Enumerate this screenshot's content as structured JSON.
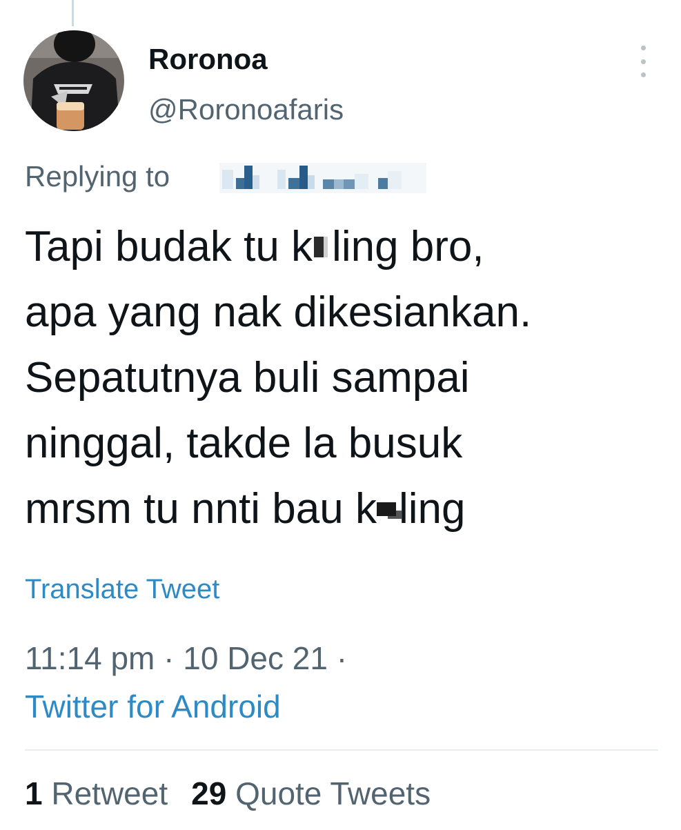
{
  "user": {
    "display_name": "Roronoa",
    "handle": "@Roronoafaris",
    "avatar_icon": "user-avatar"
  },
  "reply": {
    "label": "Replying to",
    "target_censored": true
  },
  "tweet": {
    "lines": [
      {
        "before": "Tapi budak tu k",
        "after": "ling bro,"
      },
      {
        "text": "apa yang nak dikesiankan."
      },
      {
        "text": "Sepatutnya buli sampai"
      },
      {
        "text": "ninggal, takde la busuk"
      },
      {
        "before": "mrsm tu nnti bau k",
        "after": "ling"
      }
    ]
  },
  "translate_label": "Translate Tweet",
  "timestamp": "11:14 pm · 10 Dec 21 ·",
  "source": "Twitter for Android",
  "stats": {
    "retweets_count": "1",
    "retweets_label": "Retweet",
    "quotes_count": "29",
    "quotes_label": "Quote Tweets"
  },
  "colors": {
    "text": "#0f1419",
    "secondary": "#536471",
    "link": "#2d8ac5"
  },
  "icons": {
    "more": "more-vertical-icon"
  }
}
